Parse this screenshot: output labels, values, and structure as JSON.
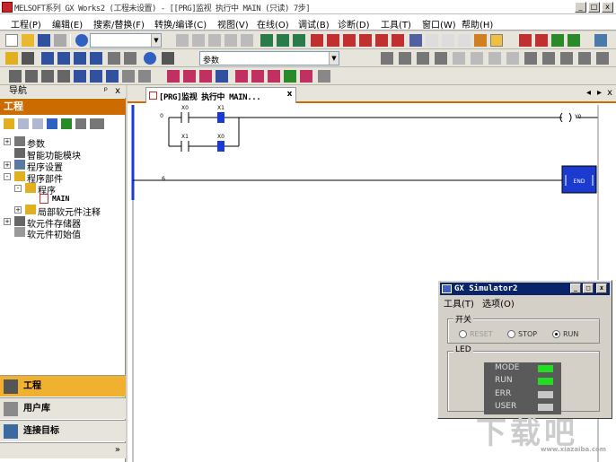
{
  "window": {
    "title": "MELSOFT系列 GX Works2 (工程未设置) - [[PRG]监视 执行中 MAIN (只读) 7步]",
    "controls": [
      "_",
      "□",
      "x"
    ]
  },
  "menu": [
    "工程(P)",
    "编辑(E)",
    "搜索/替换(F)",
    "转换/编译(C)",
    "视图(V)",
    "在线(O)",
    "调试(B)",
    "诊断(D)",
    "工具(T)",
    "窗口(W)",
    "帮助(H)"
  ],
  "toolbar": {
    "combo1_value": "",
    "combo2_value": "参数"
  },
  "navigation": {
    "title": "导航",
    "pin": "ᵖ",
    "close": "x",
    "project_header": "工程",
    "tree": [
      {
        "label": "参数",
        "expander": "+"
      },
      {
        "label": "智能功能模块",
        "expander": ""
      },
      {
        "label": "程序设置",
        "expander": "+"
      },
      {
        "label": "程序部件",
        "expander": "-"
      },
      {
        "label": "程序",
        "expander": "-"
      },
      {
        "label": "MAIN",
        "expander": ""
      },
      {
        "label": "局部软元件注释",
        "expander": "+"
      },
      {
        "label": "软元件存储器",
        "expander": "+"
      },
      {
        "label": "软元件初始值",
        "expander": ""
      }
    ],
    "bottom_buttons": [
      "工程",
      "用户库",
      "连接目标"
    ],
    "more": "»"
  },
  "editor": {
    "tab_label": "[PRG]监视 执行中 MAIN...",
    "tab_close": "x",
    "nav_arrows": [
      "◂",
      "▸",
      "x"
    ],
    "ladder": {
      "rungs": [
        {
          "step": "0",
          "contacts": [
            "X0",
            "X1"
          ],
          "parallel": [
            "X1",
            "X0"
          ],
          "coil": "Y0"
        },
        {
          "step": "6",
          "instruction": "END"
        }
      ]
    }
  },
  "simulator": {
    "title": "GX Simulator2",
    "menu": [
      "工具(T)",
      "选项(O)"
    ],
    "switch_label": "开关",
    "switch_options": [
      {
        "label": "RESET",
        "selected": false
      },
      {
        "label": "STOP",
        "selected": false
      },
      {
        "label": "RUN",
        "selected": true
      }
    ],
    "led_label": "LED",
    "leds": [
      {
        "label": "MODE",
        "color": "#22dd22"
      },
      {
        "label": "RUN",
        "color": "#22dd22"
      },
      {
        "label": "ERR",
        "color": "#c8c8c8"
      },
      {
        "label": "USER",
        "color": "#c8c8c8"
      }
    ]
  },
  "watermark": {
    "text": "下载吧",
    "url": "www.xiazaiba.com"
  }
}
